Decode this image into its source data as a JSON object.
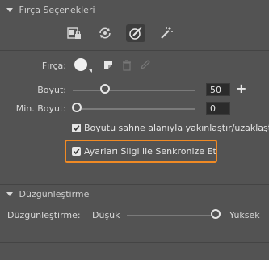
{
  "colors": {
    "panel_bg": "#535353",
    "highlight": "#f08a24",
    "thumb": "#e6e6e6"
  },
  "brush_options": {
    "header": "Fırça Seçenekleri",
    "tools": [
      {
        "icon": "lock-brush-icon"
      },
      {
        "icon": "refresh-brush-icon"
      },
      {
        "icon": "pressure-brush-icon",
        "active": true
      },
      {
        "icon": "magic-brush-icon"
      }
    ],
    "brush_label": "Fırça:",
    "size_label": "Boyut:",
    "size_value": "50",
    "size_fraction": 0.25,
    "min_size_label": "Min. Boyut:",
    "min_size_value": "0",
    "min_size_fraction": 0.0,
    "zoom_checkbox_label": "Boyutu sahne alanıyla yakınlaştır/uzaklaştır",
    "zoom_checked": true,
    "sync_checkbox_label": "Ayarları Silgi ile Senkronize Et",
    "sync_checked": true
  },
  "smoothing": {
    "header": "Düzgünleştirme",
    "label": "Düzgünleştirme:",
    "min_label": "Düşük",
    "max_label": "Yüksek",
    "fraction": 1.0
  }
}
